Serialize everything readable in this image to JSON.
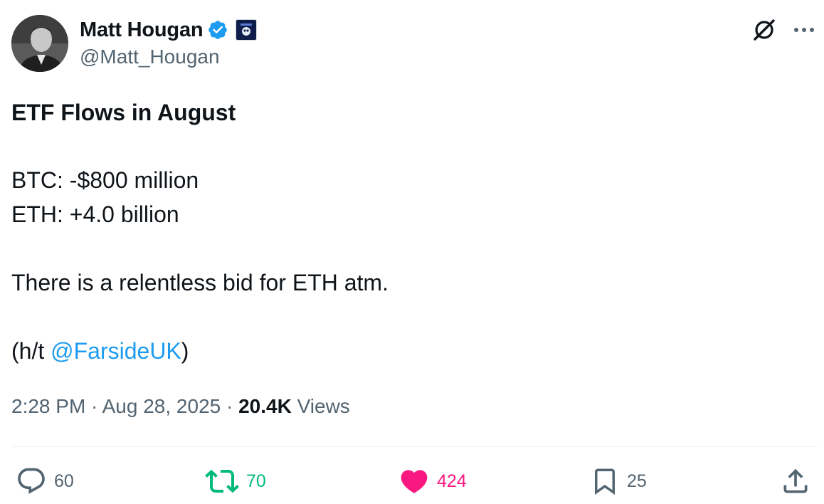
{
  "author": {
    "display_name": "Matt Hougan",
    "handle": "@Matt_Hougan",
    "verified": true
  },
  "tweet": {
    "heading": "ETF Flows in August",
    "line_btc": "BTC: -$800 million",
    "line_eth": "ETH: +4.0 billion",
    "line_bid": "There is a relentless bid for ETH atm.",
    "ht_prefix": "(h/t ",
    "ht_mention": "@FarsideUK",
    "ht_suffix": ")"
  },
  "meta": {
    "time": "2:28 PM",
    "separator": " · ",
    "date": "Aug 28, 2025",
    "views_count": "20.4K",
    "views_label": " Views"
  },
  "actions": {
    "replies": "60",
    "reposts": "70",
    "likes": "424",
    "bookmarks": "25"
  },
  "icons": {
    "avatar": "author-avatar",
    "verified": "verified-badge-icon",
    "affiliate": "affiliate-badge-icon",
    "grok": "grok-icon",
    "more": "more-dots-icon",
    "reply": "reply-bubble-icon",
    "repost": "repost-arrows-icon",
    "like": "heart-icon",
    "bookmark": "bookmark-icon",
    "share": "share-upload-icon"
  },
  "colors": {
    "text_primary": "#0f1419",
    "text_secondary": "#536471",
    "link": "#1d9bf0",
    "verified": "#1d9bf0",
    "repost_active": "#00ba7c",
    "like_active": "#f91880",
    "divider": "#eff3f4"
  }
}
